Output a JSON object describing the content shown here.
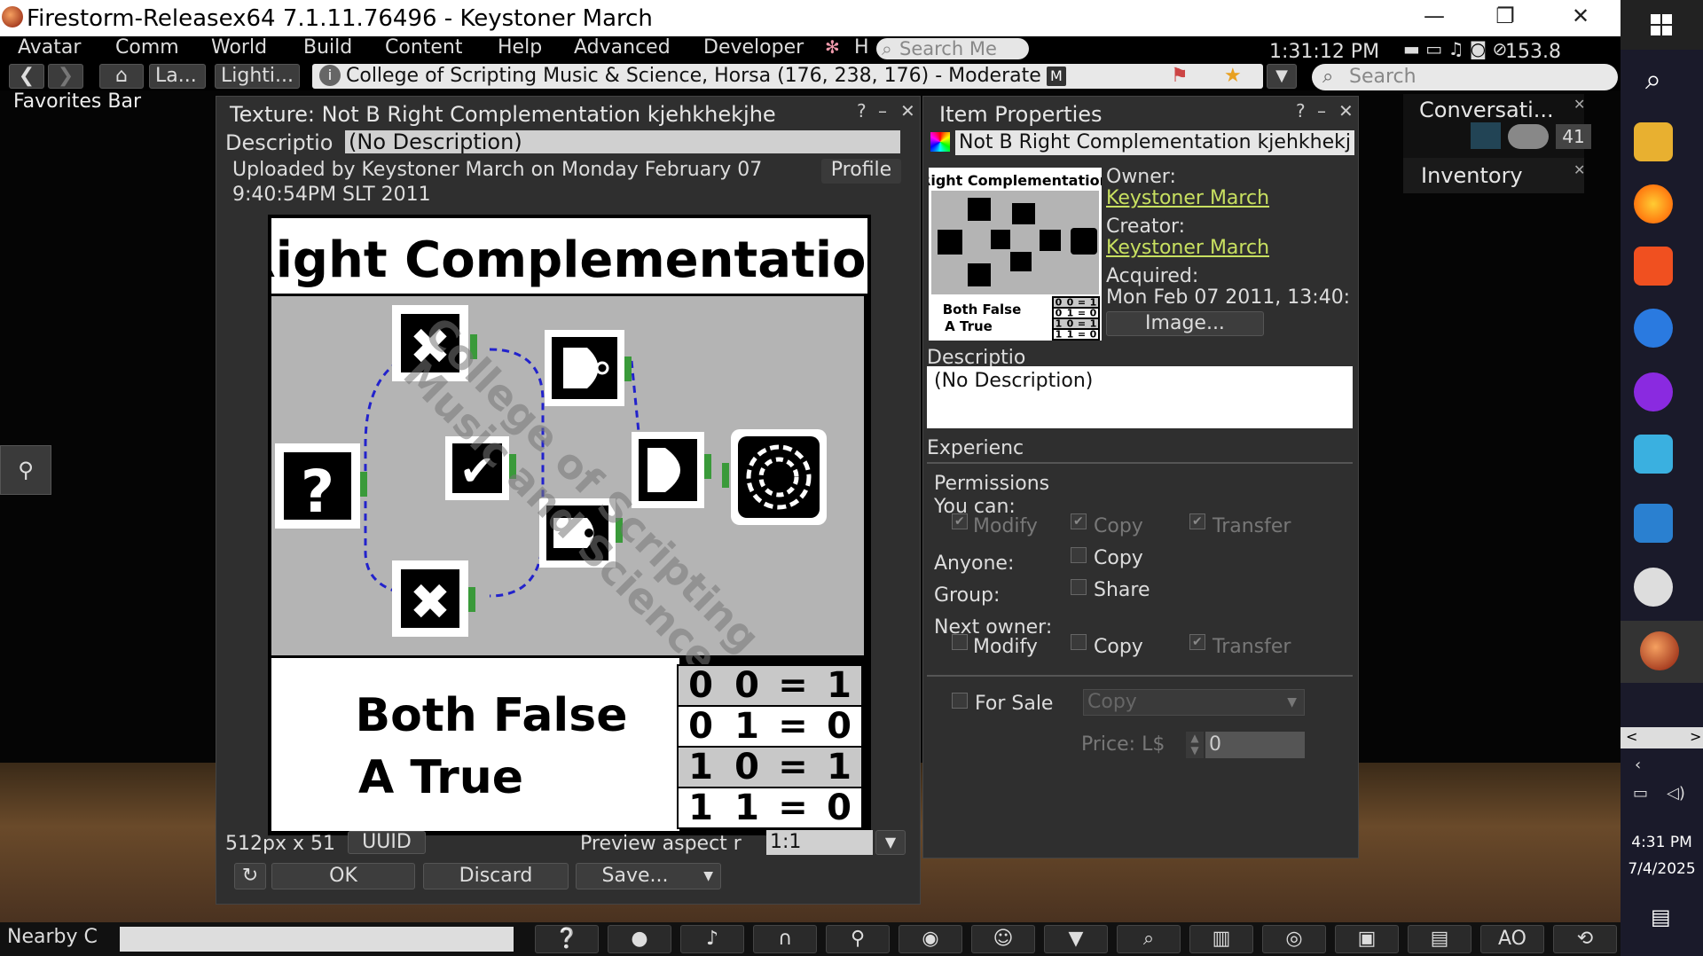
{
  "window": {
    "title": "Firestorm-Releasex64 7.1.11.76496 - Keystoner March"
  },
  "menu": {
    "items": [
      "Avatar",
      "Comm",
      "World",
      "Build",
      "Content",
      "Help",
      "Advanced",
      "Developer"
    ],
    "h_label": "H",
    "search_placeholder": "Search Me",
    "clock": "1:31:12 PM",
    "balance": "153.8"
  },
  "navbar": {
    "landmark_label": "La...",
    "lighting_label": "Lighti...",
    "location": "College of Scripting Music & Science, Horsa (176, 238, 176) - Moderate",
    "maturity_badge": "M",
    "search_placeholder": "Search"
  },
  "favorites": {
    "label": "Favorites Bar"
  },
  "texture_floater": {
    "title": "Texture: Not B Right Complementation kjehkhekjhe",
    "description_label": "Descriptio",
    "description_value": "(No Description)",
    "uploaded_line1": "Uploaded by Keystoner March on Monday February 07",
    "uploaded_line2": "9:40:54PM SLT 2011",
    "profile_button": "Profile",
    "texture": {
      "heading": "Right Complementation",
      "watermark_line1": "College of Scripting",
      "watermark_line2": "Music and Science",
      "caption_line1": "Both False",
      "caption_line2": "A True",
      "truth_table": [
        [
          "0",
          "0",
          "=",
          "1"
        ],
        [
          "0",
          "1",
          "=",
          "0"
        ],
        [
          "1",
          "0",
          "=",
          "1"
        ],
        [
          "1",
          "1",
          "=",
          "0"
        ]
      ]
    },
    "size_label": "512px x 51",
    "uuid_button": "UUID",
    "preview_aspect_label": "Preview aspect r",
    "preview_aspect_value": "1:1",
    "ok_button": "OK",
    "discard_button": "Discard",
    "save_button": "Save..."
  },
  "item_properties": {
    "title": "Item Properties",
    "name": "Not B Right Complementation kjehkhekj",
    "owner_label": "Owner:",
    "owner_name": "Keystoner March",
    "creator_label": "Creator:",
    "creator_name": "Keystoner March",
    "acquired_label": "Acquired:",
    "acquired_value": "Mon Feb 07 2011, 13:40:",
    "image_button": "Image...",
    "description_label": "Descriptio",
    "description_value": "(No Description)",
    "experience_label": "Experienc",
    "permissions_label": "Permissions",
    "you_can_label": "You can:",
    "perm_modify": "Modify",
    "perm_copy": "Copy",
    "perm_transfer": "Transfer",
    "anyone_label": "Anyone:",
    "group_label": "Group:",
    "share_label": "Share",
    "next_owner_label": "Next owner:",
    "for_sale_label": "For Sale",
    "sale_type": "Copy",
    "price_label": "Price: L$",
    "price_value": "0"
  },
  "conversations": {
    "title": "Conversati...",
    "count": "41"
  },
  "inventory": {
    "title": "Inventory"
  },
  "bottombar": {
    "nearby_chat": "Nearby C",
    "ao_label": "AO"
  },
  "system_tray": {
    "time": "4:31 PM",
    "date": "7/4/2025"
  },
  "colors": {
    "link": "#c8e060",
    "panel": "#2f2f2f",
    "title_bg": "#ffffff"
  }
}
